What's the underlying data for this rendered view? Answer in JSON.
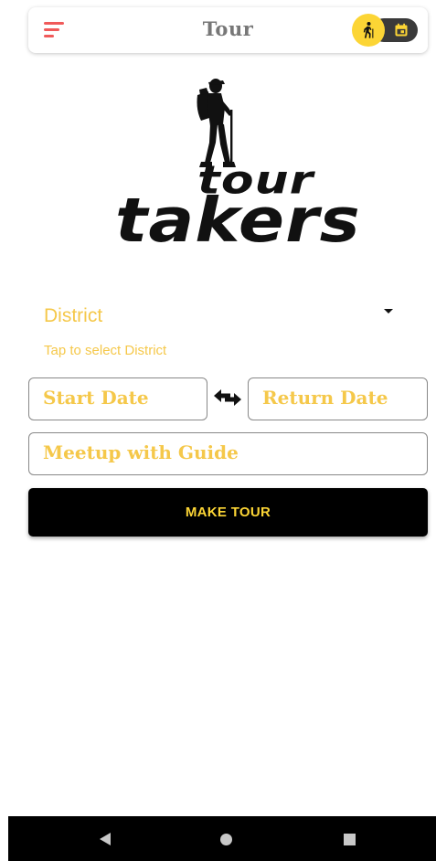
{
  "topbar": {
    "title": "Tour",
    "menu_icon": "menu-icon",
    "toggle": {
      "active_icon": "hiking-icon",
      "inactive_icon": "calendar-icon",
      "thumb_color": "#fcd535",
      "track_color": "#3a3a3a"
    }
  },
  "logo": {
    "line1": "tour",
    "line2": "takers",
    "hiker_icon": "hiker-icon"
  },
  "form": {
    "district_label": "District",
    "district_helper": "Tap to select District",
    "start_date_label": "Start Date",
    "return_date_label": "Return Date",
    "meetup_label": "Meetup with Guide",
    "swap_icon": "swap-arrows-icon",
    "submit_label": "MAKE TOUR"
  },
  "colors": {
    "accent": "#f5c84a",
    "button_bg": "#000000",
    "button_text": "#fcd535",
    "menu_icon": "#f05a5a"
  },
  "navbar": {
    "back_icon": "back-triangle-icon",
    "home_icon": "home-circle-icon",
    "recents_icon": "recents-square-icon"
  }
}
